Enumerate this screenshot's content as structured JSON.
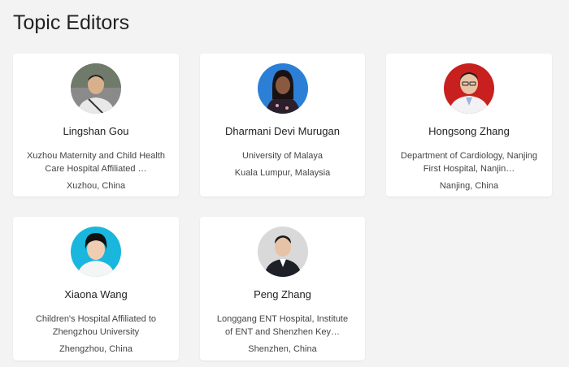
{
  "page": {
    "title": "Topic Editors"
  },
  "editors": [
    {
      "name": "Lingshan Gou",
      "affiliation": "Xuzhou Maternity and Child Health Care Hospital Affiliated …",
      "location": "Xuzhou, China",
      "avatar_bg": "#8a8a8a"
    },
    {
      "name": "Dharmani Devi Murugan",
      "affiliation": "University of Malaya",
      "location": "Kuala Lumpur, Malaysia",
      "avatar_bg": "#2c7fd6"
    },
    {
      "name": "Hongsong Zhang",
      "affiliation": "Department of Cardiology, Nanjing First Hospital, Nanjin…",
      "location": "Nanjing, China",
      "avatar_bg": "#c8201e"
    },
    {
      "name": "Xiaona Wang",
      "affiliation": "Children's Hospital Affiliated to Zhengzhou University",
      "location": "Zhengzhou, China",
      "avatar_bg": "#19b6de"
    },
    {
      "name": "Peng Zhang",
      "affiliation": "Longgang ENT Hospital, Institute of ENT and Shenzhen Key…",
      "location": "Shenzhen, China",
      "avatar_bg": "#d9d9d9"
    }
  ]
}
